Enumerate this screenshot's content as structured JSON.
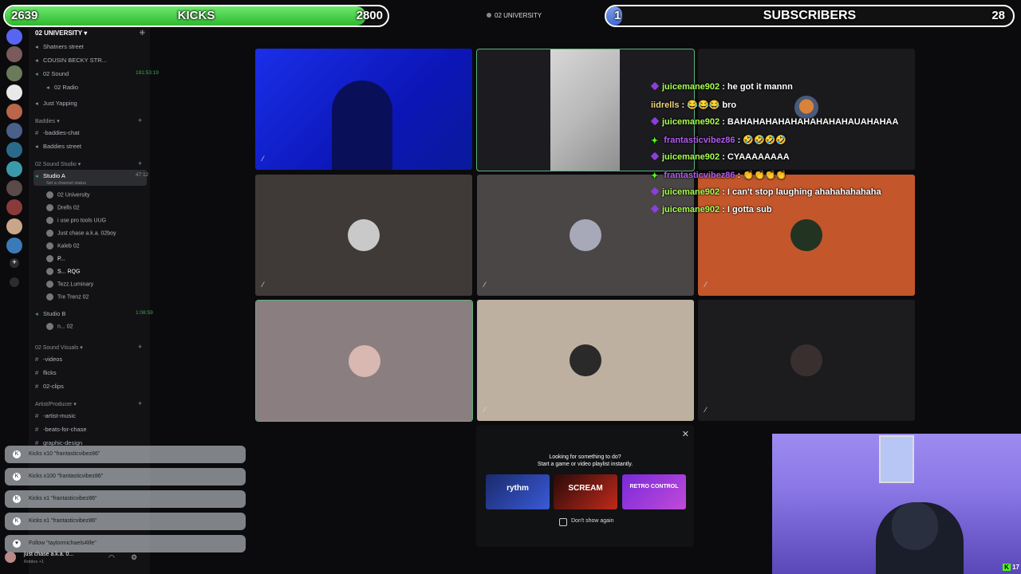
{
  "kicks_bar": {
    "current": "2639",
    "label": "KICKS",
    "goal": "2800",
    "fill_fraction": 0.943
  },
  "subs_bar": {
    "current": "1",
    "label": "SUBSCRIBERS",
    "goal": "28",
    "fill_fraction": 0.036
  },
  "stream_header": {
    "server_name": "02 UNIVERSITY"
  },
  "server": {
    "name": "02 UNIVERSITY",
    "channels_top": [
      {
        "label": "Shatners street"
      },
      {
        "label": "COUSIN BECKY STR..."
      },
      {
        "label": "02 Sound",
        "timer": "191:53:19"
      },
      {
        "label": "02 Radio"
      },
      {
        "label": "Just Yapping"
      }
    ],
    "category_baddies": "Baddies",
    "baddies_channels": [
      {
        "label": "-baddies-chat"
      },
      {
        "label": "Baddies street"
      }
    ],
    "category_studio": "02 Sound Studio",
    "studio_a": {
      "label": "Studio A",
      "timer": "47:12",
      "status": "Set a channel status"
    },
    "studio_a_members": [
      {
        "name": "02 University"
      },
      {
        "name": "Drells",
        "tag": "02"
      },
      {
        "name": "i use pro tools",
        "tag": "UUG"
      },
      {
        "name": "Just chase a.k.a. 02boy"
      },
      {
        "name": "Kaleb",
        "tag": "02"
      },
      {
        "name": "P..."
      },
      {
        "name": "S...",
        "tag": "RQG"
      },
      {
        "name": "Tezz.Luminary"
      },
      {
        "name": "Tre Trenz",
        "tag": "02"
      }
    ],
    "studio_b": {
      "label": "Studio B",
      "timer": "1:08:59"
    },
    "studio_b_members": [
      {
        "name": "n...",
        "tag": "02"
      }
    ],
    "category_visuals": "02 Sound Visuals",
    "visuals_channels": [
      {
        "label": "-videos"
      },
      {
        "label": "flicks"
      },
      {
        "label": "02-clips"
      }
    ],
    "category_artist": "Artist/Producer",
    "artist_channels": [
      {
        "label": "-artist-music"
      },
      {
        "label": "-beats-for-chase"
      },
      {
        "label": "graphic-design"
      }
    ]
  },
  "alerts": [
    {
      "text": "Kicks x10 \"frantasticvibez86\""
    },
    {
      "text": "Kicks x100 \"frantasticvibez86\""
    },
    {
      "text": "Kicks x1 \"frantasticvibez86\""
    },
    {
      "text": "Kicks x1 \"frantasticvibez86\""
    },
    {
      "text": "Follow \"taylormichaels4life\""
    }
  ],
  "user_panel": {
    "name": "just chase a.k.a. 0...",
    "status": "Roblox +1"
  },
  "chat": [
    {
      "user": "juicemane902",
      "text": " : he got it mannn",
      "badge": "purple",
      "color": "green"
    },
    {
      "user": "iidrells",
      "text": " : 😂😂😂 bro",
      "badge": "none",
      "color": "gold"
    },
    {
      "user": "juicemane902",
      "text": " : BAHAHAHAHAHAHAHAHAHAUAHAHAA",
      "badge": "purple",
      "color": "green"
    },
    {
      "user": "frantasticvibez86",
      "text": " : 🤣🤣🤣🤣",
      "badge": "green",
      "color": "purple"
    },
    {
      "user": "juicemane902",
      "text": " : CYAAAAAAAA",
      "badge": "purple",
      "color": "green"
    },
    {
      "user": "frantasticvibez86",
      "text": " : 👏👏👏👏",
      "badge": "green",
      "color": "purple"
    },
    {
      "user": "juicemane902",
      "text": " : I can't stop laughing ahahahahahaha",
      "badge": "purple",
      "color": "green"
    },
    {
      "user": "juicemane902",
      "text": " : I gotta sub",
      "badge": "purple",
      "color": "green"
    }
  ],
  "activity": {
    "line1": "Looking for something to do?",
    "line2": "Start a game or video playlist instantly.",
    "games": [
      {
        "title": "rythm"
      },
      {
        "title": "SCREAM"
      },
      {
        "title": "RETRO CONTROL"
      }
    ],
    "checkbox_label": "Don't show again"
  },
  "webcam": {
    "tag": "17"
  },
  "colors": {
    "kicks_green": "#53fc18",
    "discord_bg": "#121214",
    "speaking_outline": "#5bb37a"
  }
}
